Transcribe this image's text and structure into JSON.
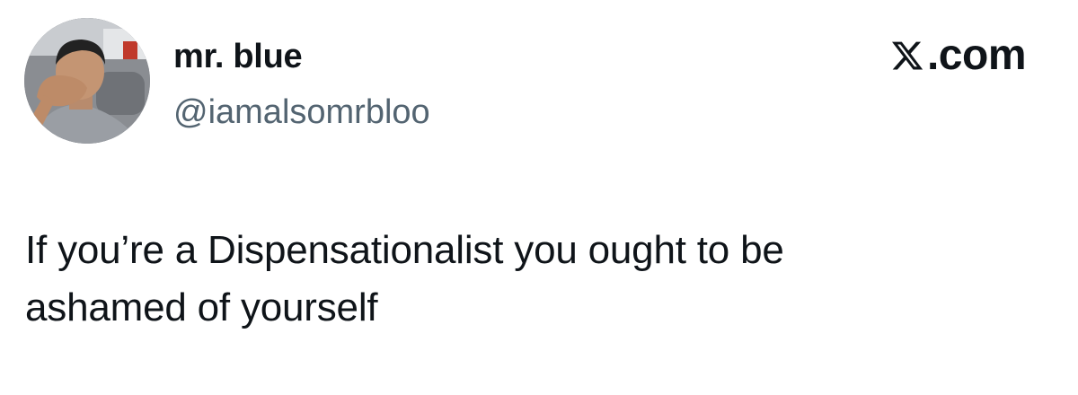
{
  "author": {
    "display_name": "mr. blue",
    "handle": "@iamalsomrbloo",
    "avatar_icon": "profile-photo"
  },
  "brand": {
    "logo_icon": "x-logo-icon",
    "text": ".com"
  },
  "tweet": {
    "text": "If you’re a Dispensationalist you ought to be\nashamed of yourself"
  },
  "colors": {
    "text_primary": "#0f1419",
    "text_secondary": "#536471",
    "background": "#ffffff"
  }
}
